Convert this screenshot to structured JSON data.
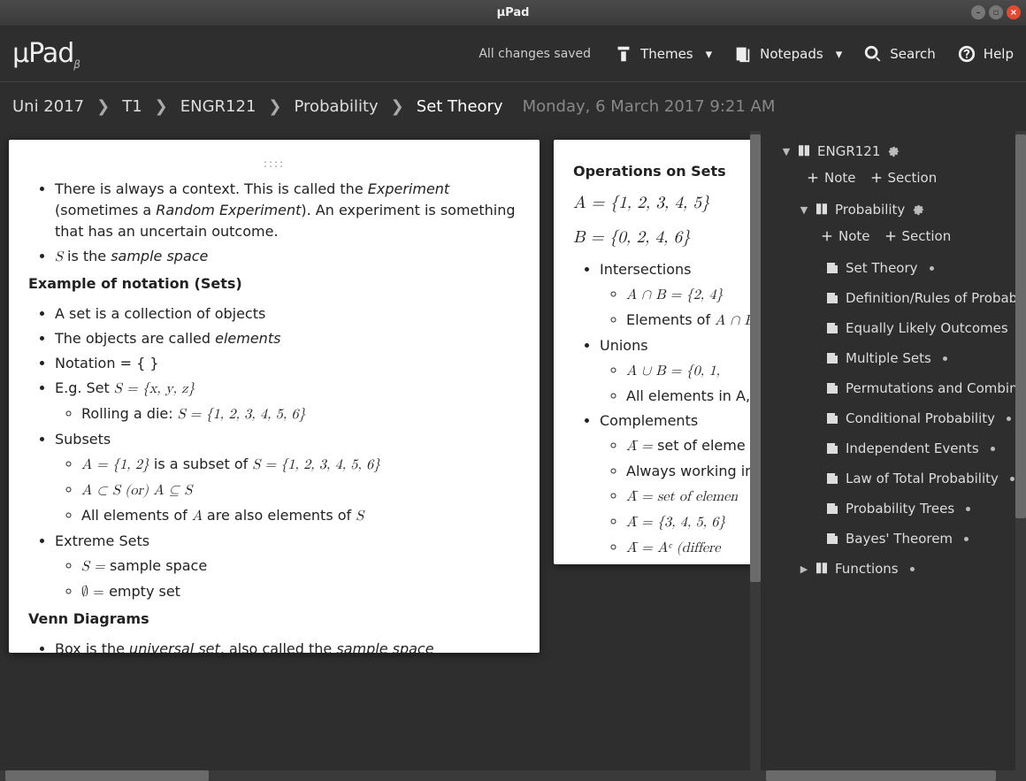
{
  "window": {
    "title": "µPad"
  },
  "app": {
    "logo_main": "µPad",
    "logo_beta": "β"
  },
  "topbar": {
    "saved": "All changes saved",
    "themes": "Themes",
    "notepads": "Notepads",
    "search": "Search",
    "help": "Help"
  },
  "breadcrumbs": {
    "items": [
      "Uni 2017",
      "T1",
      "ENGR121",
      "Probability",
      "Set Theory"
    ],
    "date": "Monday, 6 March 2017 9:21 AM"
  },
  "note1": {
    "line1_a": "There is always a context. This is called the ",
    "line1_i1": "Experiment",
    "line1_b": " (sometimes a ",
    "line1_i2": "Random Experiment",
    "line1_c": "). An experiment is something that has an uncertain outcome.",
    "line2_a": " is the ",
    "line2_i": "sample space",
    "h1": "Example of notation (Sets)",
    "b1": "A set is a collection of objects",
    "b2a": "The objects are called ",
    "b2i": "elements",
    "b3": "Notation = { }",
    "b4a": "E.g. Set ",
    "b4m": "S = {x, y, z}",
    "b4_1a": "Rolling a die: ",
    "b4_1m": "S = {1, 2, 3, 4, 5, 6}",
    "b5": "Subsets",
    "b5_1a": "A = {1, 2}",
    "b5_1b": " is a subset of ",
    "b5_1c": "S = {1, 2, 3, 4, 5, 6}",
    "b5_2": "A ⊂ S (or) A ⊆ S",
    "b5_3a": "All elements of ",
    "b5_3b": " are also elements of ",
    "b6": "Extreme Sets",
    "b6_1a": "S = ",
    "b6_1b": " sample space",
    "b6_2a": "∅ = ",
    "b6_2b": " empty set",
    "h2": "Venn Diagrams",
    "c1a": "Box is the ",
    "c1i1": "universal set",
    "c1b": ", also called the ",
    "c1i2": "sample space"
  },
  "note2": {
    "title": "Operations on Sets",
    "eqA": "A = {1, 2, 3, 4, 5}",
    "eqB": "B = {0, 2, 4, 6}",
    "int": "Intersections",
    "int1": "A ∩ B = {2, 4}",
    "int2a": "Elements of ",
    "int2b": "A ∩ B",
    "uni": "Unions",
    "uni1": "A ∪ B = {0, 1, ",
    "uni2": "All elements in A, o",
    "comp": "Complements",
    "comp1a": "A̅ = ",
    "comp1b": " set of eleme",
    "comp2": "Always working ins",
    "comp3": "A̅ = set of elemen",
    "comp4": "A̅ = {3, 4, 5, 6}",
    "comp5": "A̅ = Aᶜ (differe"
  },
  "tree": {
    "root": "ENGR121",
    "add_note": "Note",
    "add_section": "Section",
    "section": "Probability",
    "notes": [
      "Set Theory",
      "Definition/Rules of Probability",
      "Equally Likely Outcomes",
      "Multiple Sets",
      "Permutations and Combinations",
      "Conditional Probability",
      "Independent Events",
      "Law of Total Probability",
      "Probability Trees",
      "Bayes' Theorem"
    ],
    "section2": "Functions"
  }
}
